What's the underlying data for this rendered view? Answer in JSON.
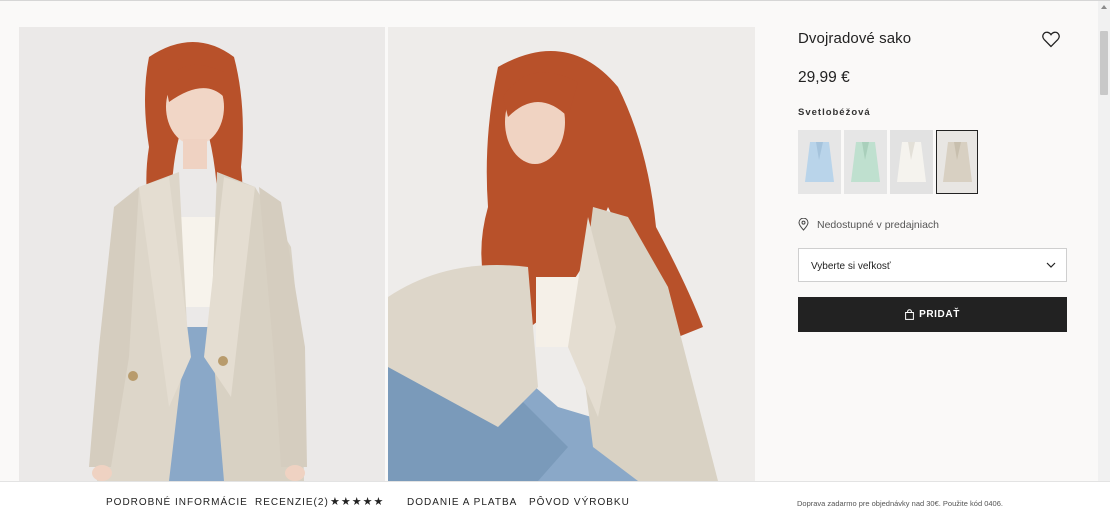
{
  "product": {
    "title": "Dvojradové sako",
    "price": "29,99 €",
    "color_name": "Svetlobéžová",
    "swatches": [
      {
        "color": "#b9d4ea",
        "selected": false
      },
      {
        "color": "#bfe0cf",
        "selected": false
      },
      {
        "color": "#f3f1ea",
        "selected": false
      },
      {
        "color": "#d8d0c2",
        "selected": true
      }
    ],
    "availability": "Nedostupné v predajniach",
    "size_select": {
      "label": "Vyberte si veľkosť"
    },
    "add_button": "PRIDAŤ"
  },
  "bottom_nav": {
    "tabs": [
      "PODROBNÉ INFORMÁCIE",
      "RECENZIE(2)",
      "DODANIE A PLATBA",
      "PÔVOD VÝROBKU"
    ],
    "rating_stars": "★★★★★",
    "shipping_note": "Doprava zadarmo pre objednávky nad 30€. Použite kód 0406."
  },
  "icons": {
    "favorite": "heart-icon",
    "location": "location-pin-icon",
    "dropdown": "chevron-down-icon",
    "bag": "shopping-bag-icon"
  },
  "colors": {
    "button_bg": "#222222",
    "page_bg": "#faf9f8",
    "blazer": "#ddd6c9",
    "hair": "#b8512a",
    "jeans": "#8aa8c8"
  }
}
